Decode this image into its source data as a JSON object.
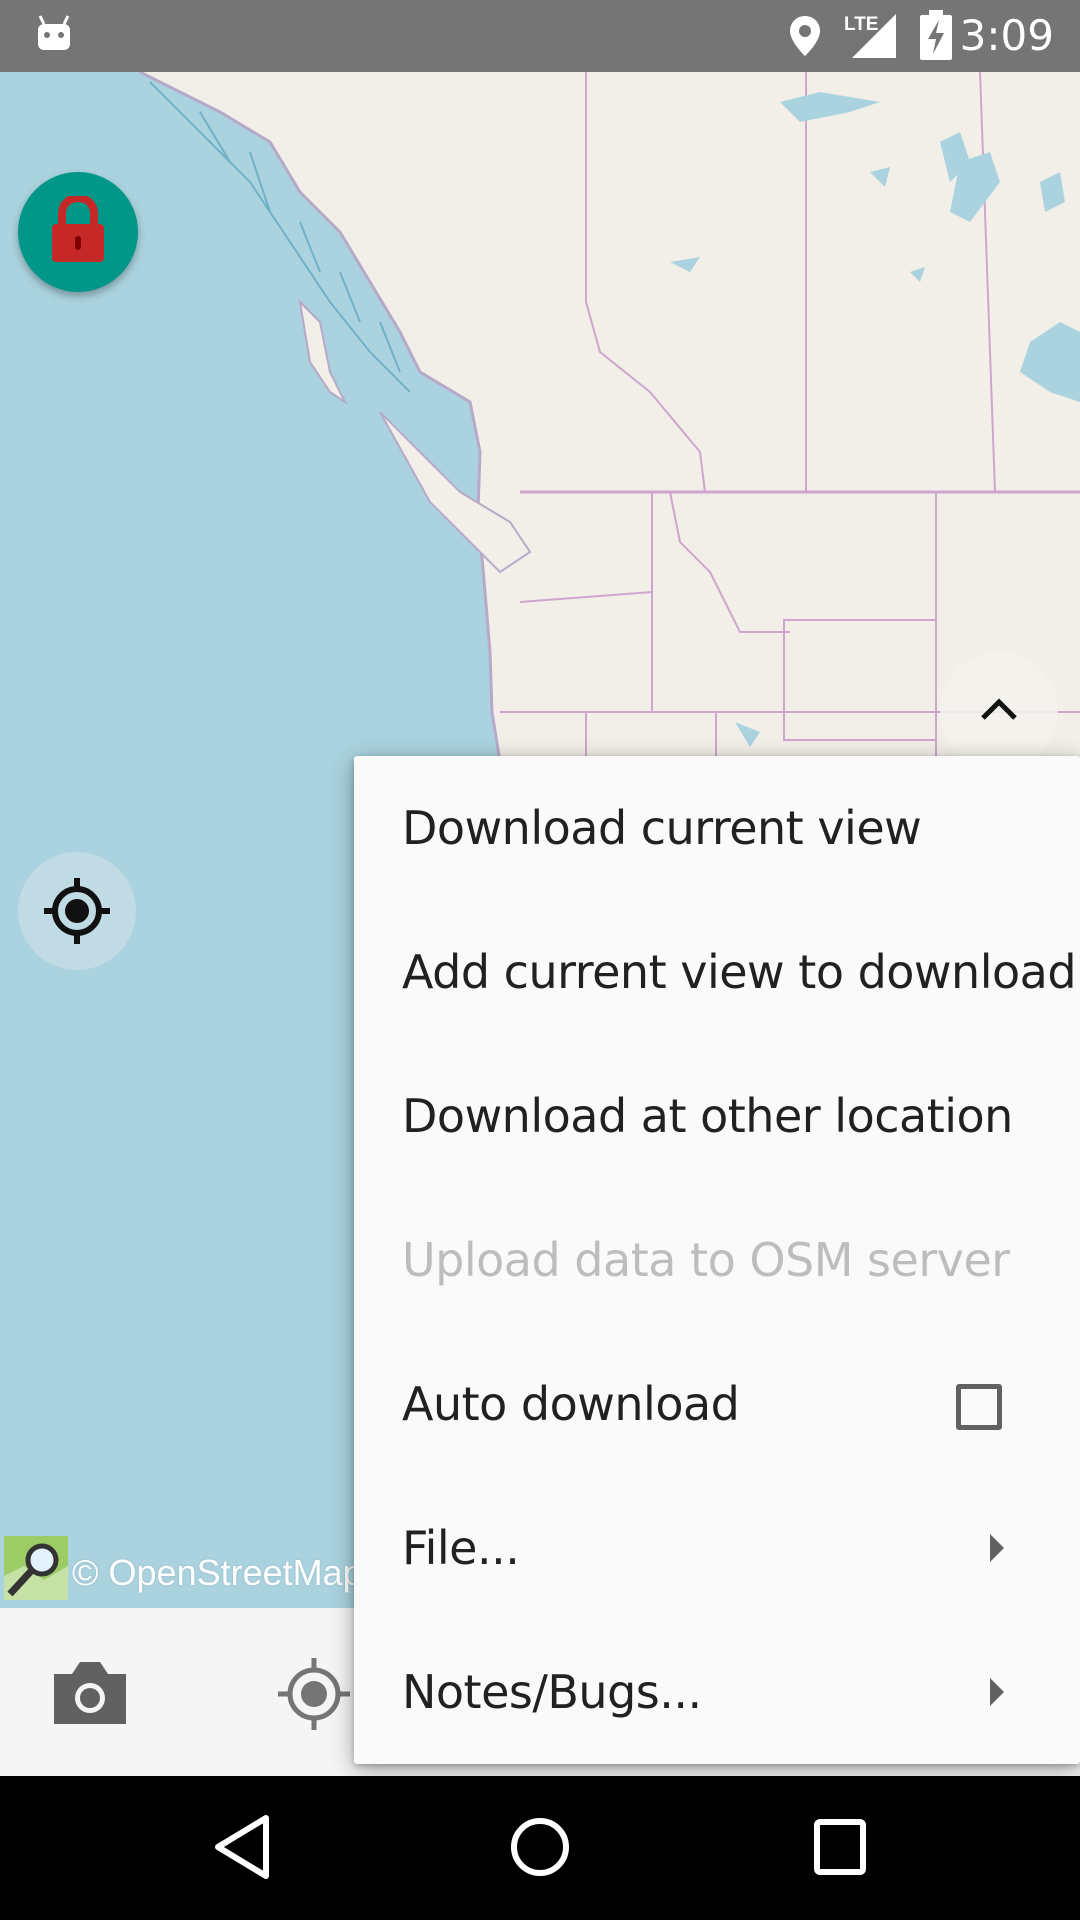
{
  "status_bar": {
    "time": "3:09",
    "network": "LTE",
    "icons": [
      "android-debug-icon",
      "location-pin-icon",
      "signal-icon",
      "battery-charging-icon"
    ]
  },
  "map": {
    "attribution": "© OpenStreetMap",
    "colors": {
      "water": "#aad3df",
      "land": "#f2efe9",
      "border": "#cfa5cf",
      "fab_lock": "#009688",
      "lock": "#c62828"
    }
  },
  "menu": {
    "items": [
      {
        "label": "Download current view",
        "enabled": true
      },
      {
        "label": "Add current view to download",
        "enabled": true
      },
      {
        "label": "Download at other location",
        "enabled": true
      },
      {
        "label": "Upload data to OSM server",
        "enabled": false
      },
      {
        "label": "Auto download",
        "enabled": true,
        "checkbox": false
      },
      {
        "label": "File...",
        "enabled": true,
        "submenu": true
      },
      {
        "label": "Notes/Bugs...",
        "enabled": true,
        "submenu": true
      }
    ]
  },
  "bottom_bar": {
    "icons": [
      "camera-icon",
      "gps-icon"
    ]
  },
  "nav_bar": {
    "icons": [
      "back-icon",
      "home-icon",
      "recents-icon"
    ]
  }
}
